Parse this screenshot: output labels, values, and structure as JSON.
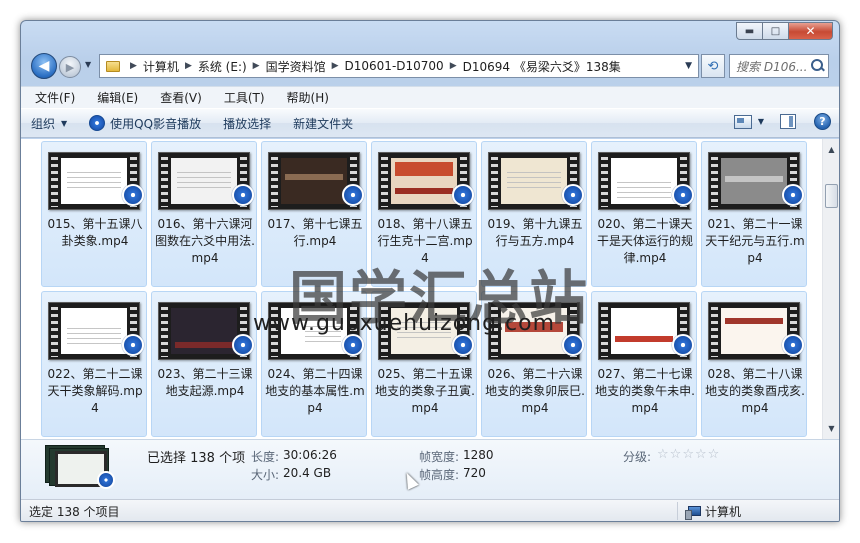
{
  "window": {
    "caption_buttons": {
      "minimize": "▬",
      "maximize": "□",
      "close": "✕"
    }
  },
  "address": {
    "breadcrumbs": [
      "计算机",
      "系统 (E:)",
      "国学资料馆",
      "D10601-D10700",
      "D10694 《易梁六爻》138集"
    ]
  },
  "search": {
    "placeholder": "搜索 D106..."
  },
  "menu": {
    "items": [
      "文件(F)",
      "编辑(E)",
      "查看(V)",
      "工具(T)",
      "帮助(H)"
    ]
  },
  "toolbar": {
    "organize": "组织",
    "play_qq": "使用QQ影音播放",
    "play_selection": "播放选择",
    "new_folder": "新建文件夹"
  },
  "files": {
    "row1": [
      {
        "label": "015、第十五课八卦类象.mp4",
        "accent": "#ffffff"
      },
      {
        "label": "016、第十六课河图数在六爻中用法.mp4",
        "accent": "#f2f2f2"
      },
      {
        "label": "017、第十七课五行.mp4",
        "accent": "#3a2a22"
      },
      {
        "label": "018、第十八课五行生克十二宫.mp4",
        "accent": "#c84c2e"
      },
      {
        "label": "019、第十九课五行与五方.mp4",
        "accent": "#efe6d2"
      },
      {
        "label": "020、第二十课天干是天体运行的规律.mp4",
        "accent": "#ffffff"
      },
      {
        "label": "021、第二十一课天干纪元与五行.mp4",
        "accent": "#8b8b8b"
      }
    ],
    "row2": [
      {
        "label": "022、第二十二课天干类象解码.mp4",
        "accent": "#ffffff"
      },
      {
        "label": "023、第二十三课地支起源.mp4",
        "accent": "#2b2530"
      },
      {
        "label": "024、第二十四课地支的基本属性.mp4",
        "accent": "#ffffff"
      },
      {
        "label": "025、第二十五课地支的类象子丑寅.mp4",
        "accent": "#f4efe4"
      },
      {
        "label": "026、第二十六课地支的类象卯辰巳.mp4",
        "accent": "#f7f2ea"
      },
      {
        "label": "027、第二十七课地支的类象午未申.mp4",
        "accent": "#ffffff"
      },
      {
        "label": "028、第二十八课地支的类象酉戌亥.mp4",
        "accent": "#fbf5ee"
      }
    ]
  },
  "watermark": {
    "cn": "国学汇总站",
    "url": "www.guoxuehuizong.com"
  },
  "details": {
    "selected": "已选择 138 个项",
    "length_label": "长度:",
    "length_value": "30:06:26",
    "size_label": "大小:",
    "size_value": "20.4 GB",
    "frame_width_label": "帧宽度:",
    "frame_width_value": "1280",
    "frame_height_label": "帧高度:",
    "frame_height_value": "720",
    "rating_label": "分级:",
    "rating_value": 0
  },
  "status": {
    "left": "选定 138 个项目",
    "right": "计算机"
  }
}
